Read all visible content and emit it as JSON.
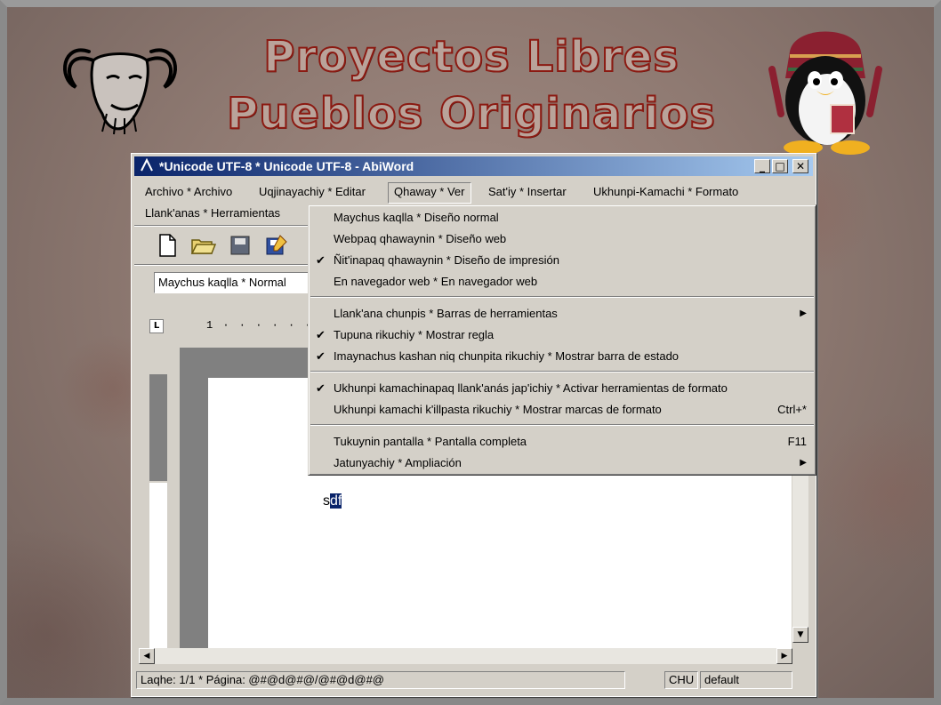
{
  "slide": {
    "title_line1": "Proyectos Libres",
    "title_line2": "Pueblos Originarios"
  },
  "window": {
    "title": "*Unicode UTF-8 * Unicode UTF-8 - AbiWord",
    "minimize": "_",
    "maximize": "□",
    "close": "✕"
  },
  "menubar": {
    "items": [
      {
        "label": "Archivo * Archivo"
      },
      {
        "label": "Uqjinayachiy * Editar"
      },
      {
        "label": "Qhaway * Ver"
      },
      {
        "label": "Sat'iy * Insertar"
      },
      {
        "label": "Ukhunpi-Kamachi * Formato"
      },
      {
        "label": "Llank'anas * Herramientas"
      }
    ]
  },
  "toolbar": {
    "style_value": "Maychus kaqlla * Normal"
  },
  "view_menu": {
    "items": [
      {
        "label": "Maychus kaqlla * Diseño normal",
        "checked": false
      },
      {
        "label": "Webpaq qhawaynin * Diseño web",
        "checked": false
      },
      {
        "label": "Ñit'inapaq qhawaynin * Diseño de impresión",
        "checked": true
      },
      {
        "label": "En navegador web * En navegador web",
        "checked": false
      },
      {
        "label": "Llank'ana chunpis * Barras de herramientas",
        "checked": false,
        "submenu": true
      },
      {
        "label": "Tupuna rikuchiy * Mostrar regla",
        "checked": true
      },
      {
        "label": "Imaynachus kashan niq chunpita rikuchiy * Mostrar barra de estado",
        "checked": true
      },
      {
        "label": "Ukhunpi kamachinapaq llank'anás jap'ichiy * Activar herramientas de formato",
        "checked": true
      },
      {
        "label": "Ukhunpi kamachi k'illpasta rikuchiy * Mostrar marcas de formato",
        "checked": false,
        "shortcut": "Ctrl+*"
      },
      {
        "label": "Tukuynin pantalla * Pantalla completa",
        "checked": false,
        "shortcut": "F11"
      },
      {
        "label": "Jatunyachiy * Ampliación",
        "checked": false,
        "submenu": true
      }
    ],
    "check_glyph": "✔",
    "submenu_glyph": "▶"
  },
  "ruler": {
    "tab_marker": "L",
    "h_text": "1 · · · · · ·"
  },
  "document": {
    "text_plain": "s",
    "text_selected": "df"
  },
  "statusbar": {
    "page": "Laqhe: 1/1 * Página: @#@d@#@/@#@d@#@",
    "lang": "CHU",
    "style": "default"
  },
  "colors": {
    "title_stroke": "#8b1a12",
    "titlebar_start": "#0a246a",
    "titlebar_end": "#a6caf0",
    "selection": "#0a246a"
  }
}
